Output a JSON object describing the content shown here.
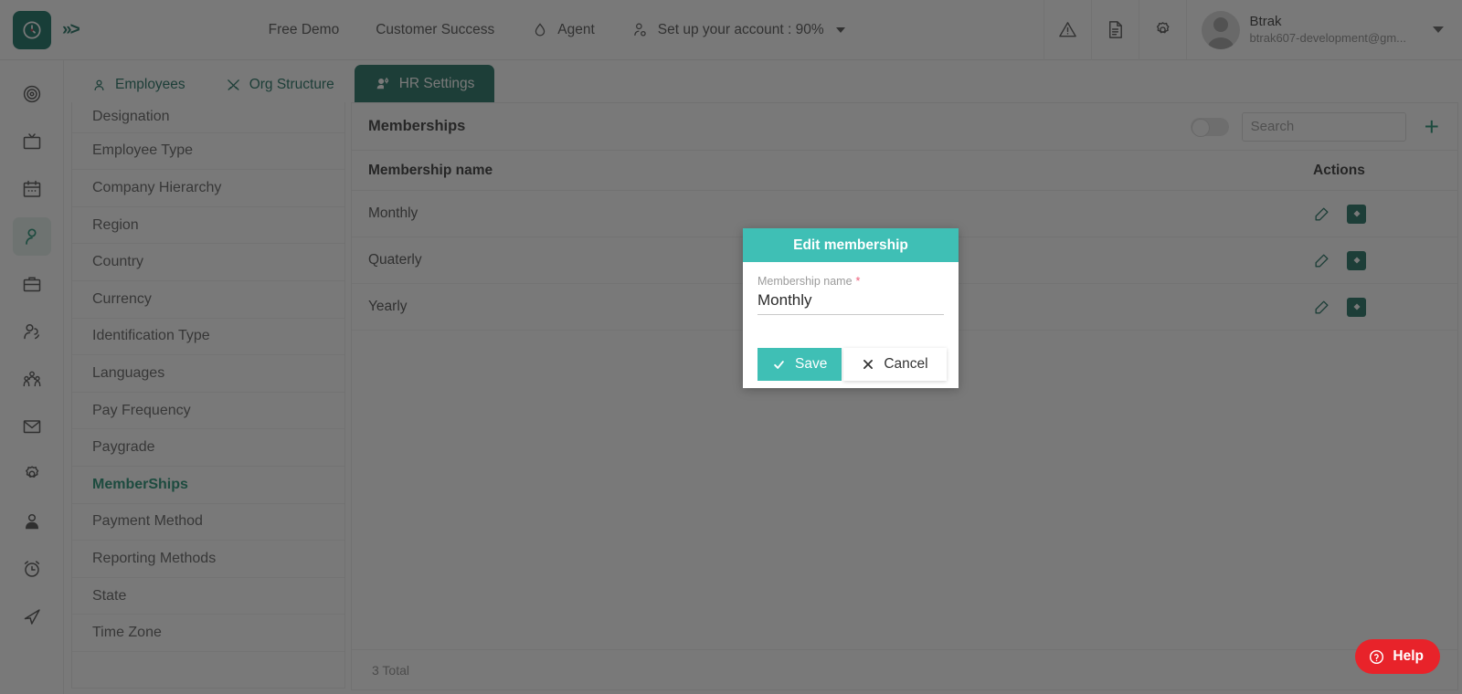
{
  "topbar": {
    "logo_icon": "clock-logo-icon",
    "expand_icon": "chevron-double-right-icon",
    "nav": [
      {
        "label": "Free Demo",
        "icon": null
      },
      {
        "label": "Customer Success",
        "icon": null
      },
      {
        "label": "Agent",
        "icon": "agent-cloud-icon"
      },
      {
        "label": "Set up your account : 90%",
        "icon": "person-check-icon",
        "has_caret": true
      }
    ],
    "icons": [
      "warning-triangle-icon",
      "document-icon",
      "gear-icon"
    ],
    "account": {
      "name": "Btrak",
      "email": "btrak607-development@gm...",
      "avatar_icon": "avatar-placeholder-icon",
      "caret_icon": "chevron-down-icon"
    }
  },
  "rail": {
    "items": [
      {
        "name": "dashboard-target-icon",
        "active": false
      },
      {
        "name": "monitor-tv-icon",
        "active": false
      },
      {
        "name": "calendar-icon",
        "active": false
      },
      {
        "name": "person-icon",
        "active": true
      },
      {
        "name": "briefcase-icon",
        "active": false
      },
      {
        "name": "people-icon",
        "active": false
      },
      {
        "name": "group-icon",
        "active": false
      },
      {
        "name": "mail-icon",
        "active": false
      },
      {
        "name": "gear-icon",
        "active": false
      },
      {
        "name": "user-badge-icon",
        "active": false
      },
      {
        "name": "alarm-clock-icon",
        "active": false
      },
      {
        "name": "send-arrow-icon",
        "active": false
      }
    ]
  },
  "tabs": [
    {
      "label": "Employees",
      "icon": "person-icon",
      "active": false
    },
    {
      "label": "Org Structure",
      "icon": "tools-icon",
      "active": false
    },
    {
      "label": "HR Settings",
      "icon": "user-settings-icon",
      "active": true
    }
  ],
  "settings_list": [
    {
      "label": "Designation",
      "active": false
    },
    {
      "label": "Employee Type",
      "active": false
    },
    {
      "label": "Company Hierarchy",
      "active": false
    },
    {
      "label": "Region",
      "active": false
    },
    {
      "label": "Country",
      "active": false
    },
    {
      "label": "Currency",
      "active": false
    },
    {
      "label": "Identification Type",
      "active": false
    },
    {
      "label": "Languages",
      "active": false
    },
    {
      "label": "Pay Frequency",
      "active": false
    },
    {
      "label": "Paygrade",
      "active": false
    },
    {
      "label": "MemberShips",
      "active": true
    },
    {
      "label": "Payment Method",
      "active": false
    },
    {
      "label": "Reporting Methods",
      "active": false
    },
    {
      "label": "State",
      "active": false
    },
    {
      "label": "Time Zone",
      "active": false
    }
  ],
  "panel": {
    "title": "Memberships",
    "search_placeholder": "Search",
    "search_value": "",
    "toggle_state": "off",
    "add_label": "+",
    "columns": [
      "Membership name",
      "Actions"
    ],
    "rows": [
      {
        "name": "Monthly",
        "edit_icon": "edit-pencil-icon",
        "action_icon": "delete-square-icon"
      },
      {
        "name": "Quaterly",
        "edit_icon": "edit-pencil-icon",
        "action_icon": "delete-square-icon"
      },
      {
        "name": "Yearly",
        "edit_icon": "edit-pencil-icon",
        "action_icon": "delete-square-icon"
      }
    ],
    "footer_total": "3 Total"
  },
  "modal": {
    "title": "Edit membership",
    "field_label": "Membership name",
    "required_mark": "*",
    "field_value": "Monthly",
    "save_label": "Save",
    "cancel_label": "Cancel",
    "save_icon": "check-icon",
    "cancel_icon": "close-x-icon"
  },
  "help": {
    "label": "Help",
    "icon": "question-circle-icon"
  },
  "colors": {
    "brand_dark": "#1a6d5c",
    "brand_teal": "#3fbfb5",
    "accent_green": "#1a8c6f",
    "required_red": "#ee5b78",
    "help_red": "#e8232a",
    "overlay": "rgba(32,32,32,0.60)"
  }
}
